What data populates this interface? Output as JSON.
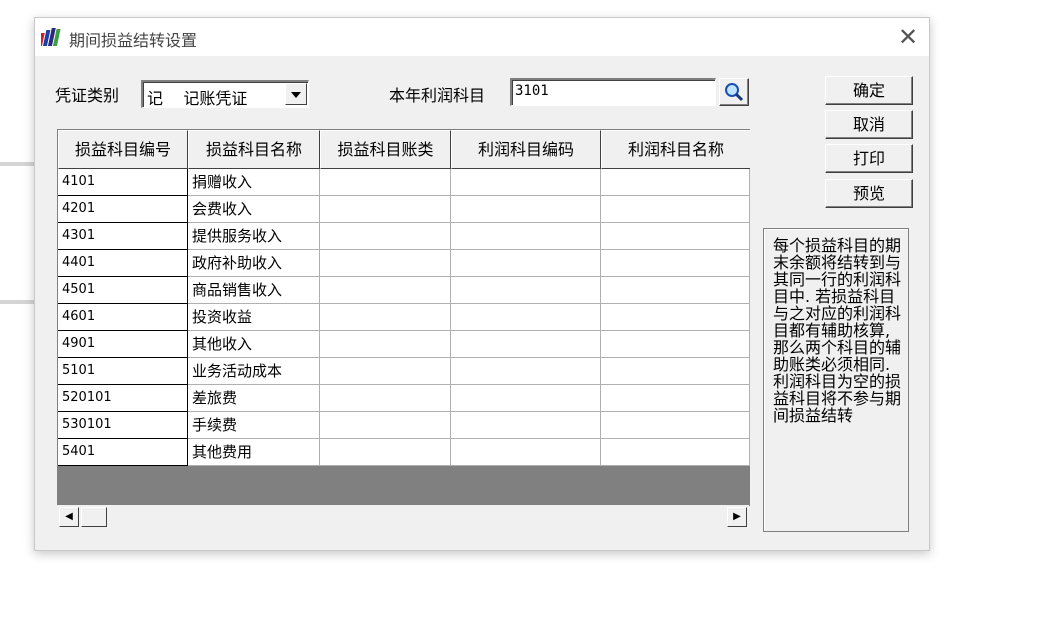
{
  "window": {
    "title": "期间损益结转设置",
    "close_glyph": "✕"
  },
  "toolbar": {
    "voucher_type_label": "凭证类别",
    "voucher_type_value": "记    记账凭证",
    "profit_account_label": "本年利润科目",
    "profit_account_value": "3101"
  },
  "buttons": {
    "ok": "确定",
    "cancel": "取消",
    "print": "打印",
    "preview": "预览"
  },
  "table": {
    "columns": [
      "损益科目编号",
      "损益科目名称",
      "损益科目账类",
      "利润科目编码",
      "利润科目名称"
    ],
    "rows": [
      [
        "4101",
        "捐赠收入",
        "",
        "",
        ""
      ],
      [
        "4201",
        "会费收入",
        "",
        "",
        ""
      ],
      [
        "4301",
        "提供服务收入",
        "",
        "",
        ""
      ],
      [
        "4401",
        "政府补助收入",
        "",
        "",
        ""
      ],
      [
        "4501",
        "商品销售收入",
        "",
        "",
        ""
      ],
      [
        "4601",
        "投资收益",
        "",
        "",
        ""
      ],
      [
        "4901",
        "其他收入",
        "",
        "",
        ""
      ],
      [
        "5101",
        "业务活动成本",
        "",
        "",
        ""
      ],
      [
        "520101",
        "差旅费",
        "",
        "",
        ""
      ],
      [
        "530101",
        "手续费",
        "",
        "",
        ""
      ],
      [
        "5401",
        "其他费用",
        "",
        "",
        ""
      ]
    ]
  },
  "scrollbar": {
    "left_arrow": "◀",
    "right_arrow": "▶"
  },
  "note": {
    "text": "每个损益科目的期末余额将结转到与其同一行的利润科目中. 若损益科目与之对应的利润科目都有辅助核算,那么两个科目的辅助账类必须相同. 利润科目为空的损益科目将不参与期间损益结转"
  },
  "icons": {
    "dropdown": "dropdown-arrow-icon",
    "search": "search-icon",
    "app": "books-icon"
  },
  "colors": {
    "dialog_bg": "#f0f0f0",
    "grid_bg": "#808080"
  }
}
